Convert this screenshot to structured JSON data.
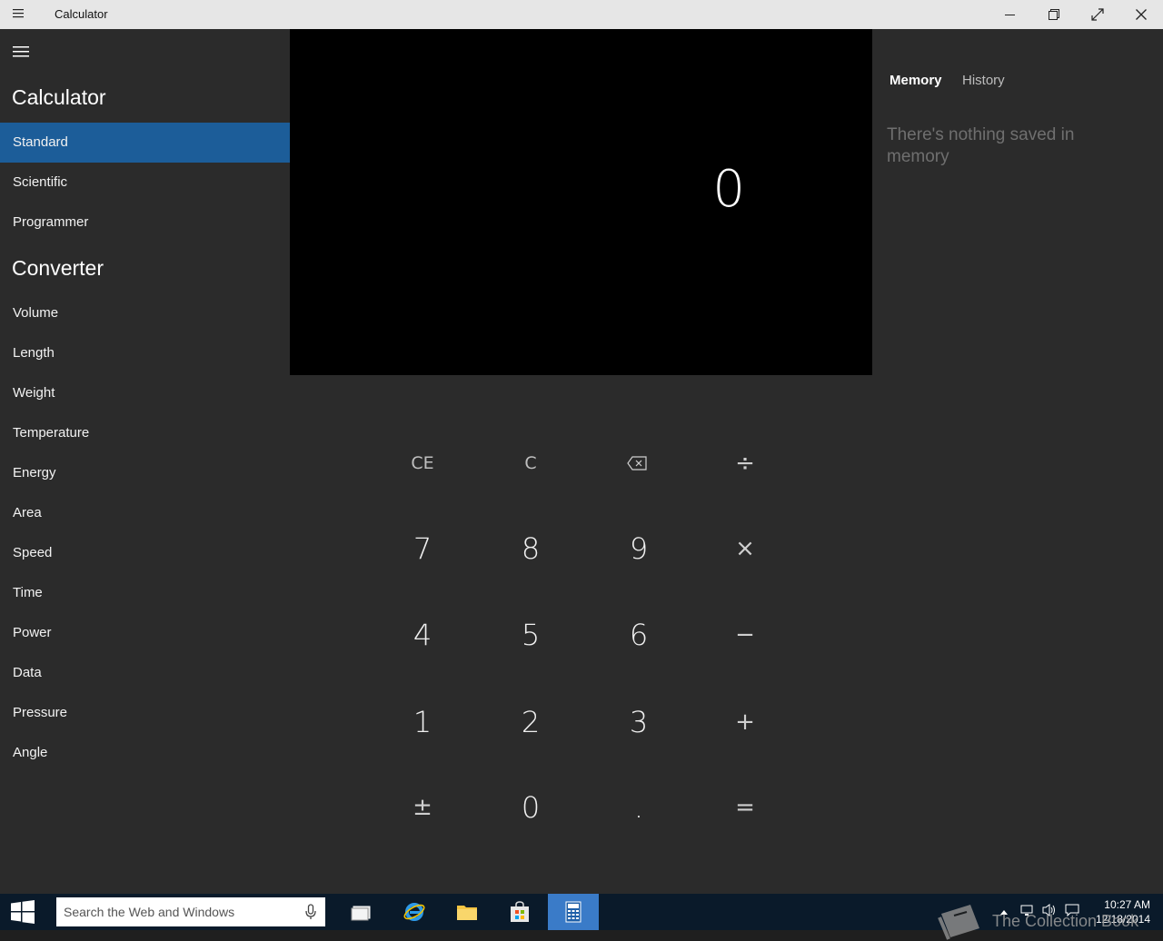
{
  "window": {
    "title": "Calculator"
  },
  "sidebar": {
    "calculator_heading": "Calculator",
    "calculator_items": [
      "Standard",
      "Scientific",
      "Programmer"
    ],
    "active_item": "Standard",
    "converter_heading": "Converter",
    "converter_items": [
      "Volume",
      "Length",
      "Weight",
      "Temperature",
      "Energy",
      "Area",
      "Speed",
      "Time",
      "Power",
      "Data",
      "Pressure",
      "Angle"
    ]
  },
  "display": {
    "value": "0"
  },
  "keypad": {
    "rows": [
      [
        "CE",
        "C",
        "⌫",
        "÷"
      ],
      [
        "7",
        "8",
        "9",
        "×"
      ],
      [
        "4",
        "5",
        "6",
        "−"
      ],
      [
        "1",
        "2",
        "3",
        "+"
      ],
      [
        "±",
        "0",
        ".",
        "="
      ]
    ]
  },
  "right_panel": {
    "tabs": [
      "Memory",
      "History"
    ],
    "active_tab": "Memory",
    "empty_message": "There's nothing saved in memory"
  },
  "taskbar": {
    "search_placeholder": "Search the Web and Windows",
    "clock_time": "10:27 AM",
    "clock_date": "12/18/2014"
  },
  "watermark": {
    "text": "The Collection Book"
  },
  "colors": {
    "accent": "#1c5d99",
    "taskbar_active": "#3a7bc8",
    "sidebar_bg": "#2b2b2b",
    "display_bg": "#000000"
  }
}
